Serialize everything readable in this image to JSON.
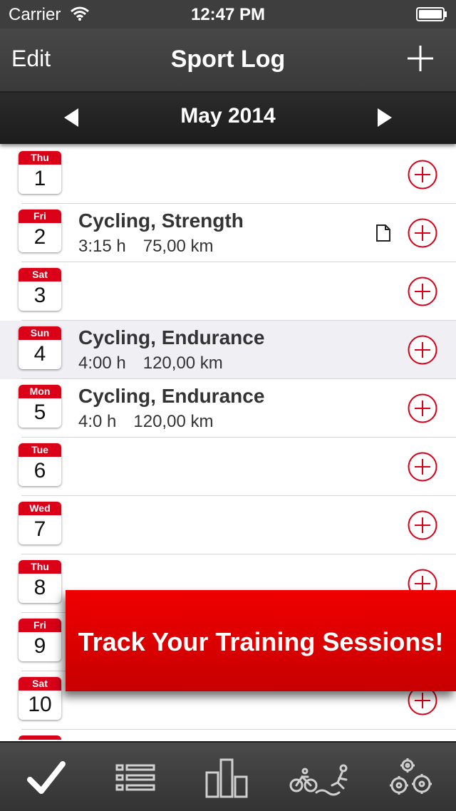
{
  "status_bar": {
    "carrier": "Carrier",
    "time": "12:47 PM"
  },
  "nav": {
    "edit_label": "Edit",
    "title": "Sport Log"
  },
  "month_bar": {
    "label": "May 2014"
  },
  "days": [
    {
      "dow": "Thu",
      "day": "1",
      "title": "",
      "duration": "",
      "distance": "",
      "has_note": false,
      "selected": false
    },
    {
      "dow": "Fri",
      "day": "2",
      "title": "Cycling, Strength",
      "duration": "3:15 h",
      "distance": "75,00 km",
      "has_note": true,
      "selected": false
    },
    {
      "dow": "Sat",
      "day": "3",
      "title": "",
      "duration": "",
      "distance": "",
      "has_note": false,
      "selected": false
    },
    {
      "dow": "Sun",
      "day": "4",
      "title": "Cycling, Endurance",
      "duration": "4:00 h",
      "distance": "120,00 km",
      "has_note": false,
      "selected": true
    },
    {
      "dow": "Mon",
      "day": "5",
      "title": "Cycling, Endurance",
      "duration": "4:0 h",
      "distance": "120,00 km",
      "has_note": false,
      "selected": false
    },
    {
      "dow": "Tue",
      "day": "6",
      "title": "",
      "duration": "",
      "distance": "",
      "has_note": false,
      "selected": false
    },
    {
      "dow": "Wed",
      "day": "7",
      "title": "",
      "duration": "",
      "distance": "",
      "has_note": false,
      "selected": false
    },
    {
      "dow": "Thu",
      "day": "8",
      "title": "",
      "duration": "",
      "distance": "",
      "has_note": false,
      "selected": false
    },
    {
      "dow": "Fri",
      "day": "9",
      "title": "",
      "duration": "",
      "distance": "",
      "has_note": false,
      "selected": false
    },
    {
      "dow": "Sat",
      "day": "10",
      "title": "",
      "duration": "",
      "distance": "",
      "has_note": false,
      "selected": false
    }
  ],
  "promo_banner": {
    "text": "Track Your Training Sessions!"
  },
  "tab_bar": {
    "items": [
      "checkmark-icon",
      "list-icon",
      "bar-chart-icon",
      "triathlon-icon",
      "settings-gears-icon"
    ]
  },
  "colors": {
    "accent_red": "#d90018",
    "bar_dark": "#3e3e3e",
    "banner_red": "#e00000"
  }
}
